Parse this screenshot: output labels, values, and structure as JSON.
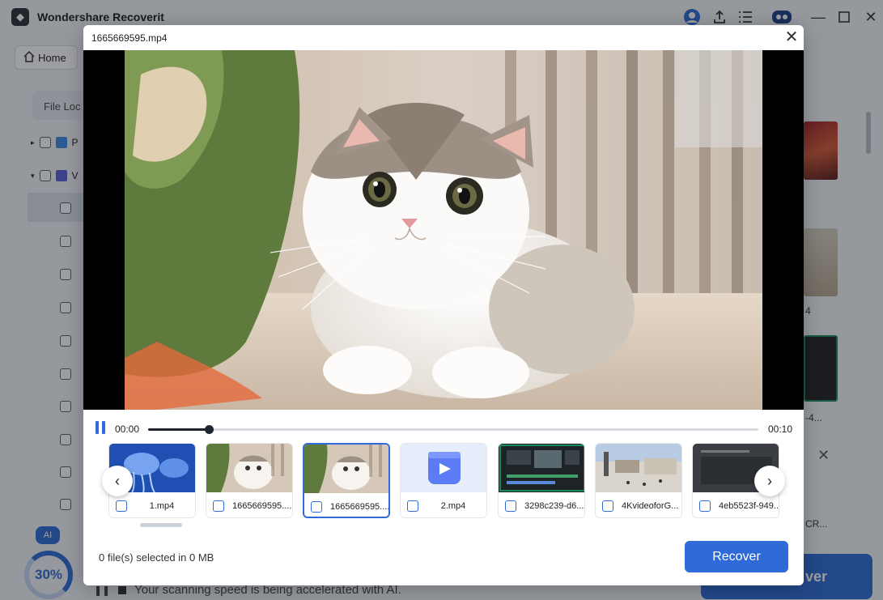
{
  "app": {
    "title": "Wondershare Recoverit",
    "nav_home": "Home",
    "file_location_label": "File Loc",
    "tree_items": [
      {
        "label": "P"
      },
      {
        "label": "V"
      }
    ],
    "right_labels": [
      "4",
      "-4...",
      "CR..."
    ],
    "progress_percent": 30,
    "progress_text": "30%",
    "status_text": "Your scanning speed is being accelerated with AI.",
    "recover_big_label": "ver",
    "robot_label": "AI"
  },
  "modal": {
    "title": "1665669595.mp4",
    "time_current": "00:00",
    "time_total": "00:10",
    "progress_fraction": 0.1,
    "thumbnails": [
      {
        "name": "1.mp4",
        "kind": "jellyfish",
        "selected": false
      },
      {
        "name": "1665669595....",
        "kind": "cat",
        "selected": false
      },
      {
        "name": "1665669595....",
        "kind": "cat",
        "selected": true
      },
      {
        "name": "2.mp4",
        "kind": "video-icon",
        "selected": false
      },
      {
        "name": "3298c239-d6...",
        "kind": "editor",
        "selected": false
      },
      {
        "name": "4KvideoforG...",
        "kind": "street",
        "selected": false
      },
      {
        "name": "4eb5523f-949...",
        "kind": "dark",
        "selected": false
      }
    ],
    "selection_info": "0 file(s) selected in 0 MB",
    "recover_label": "Recover"
  },
  "colors": {
    "accent": "#2f6bd8"
  }
}
